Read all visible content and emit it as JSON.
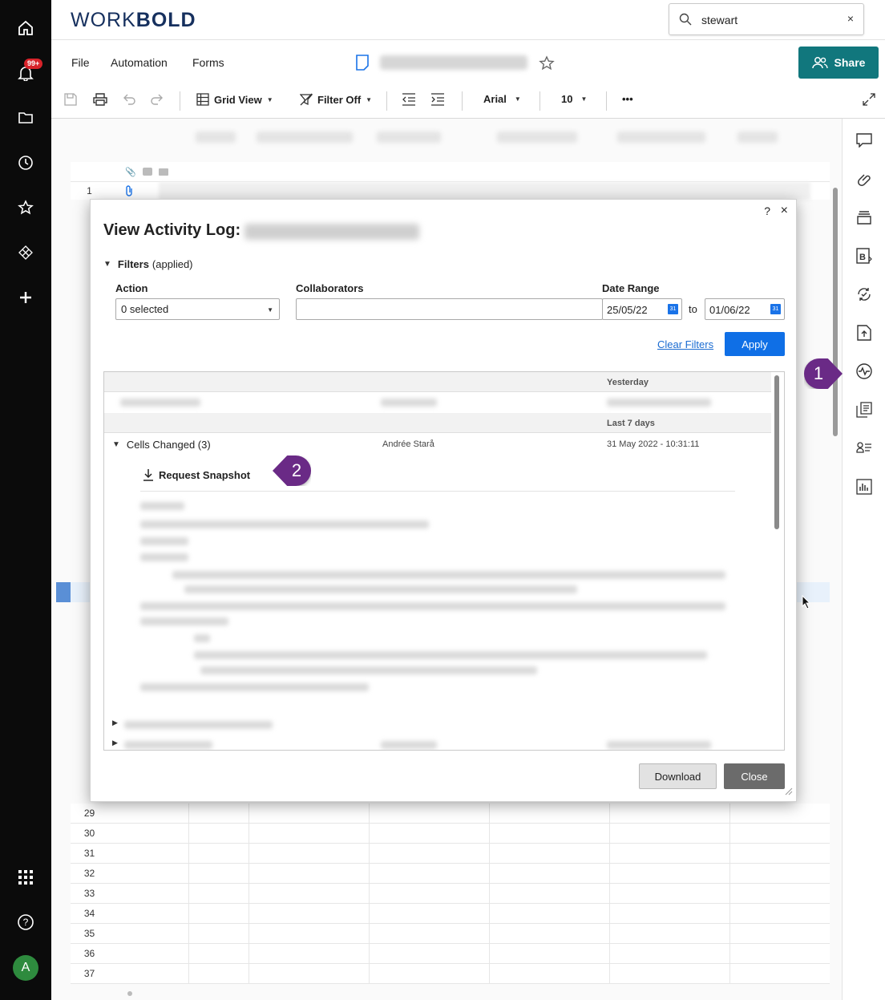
{
  "app": {
    "logo_light": "WORK",
    "logo_bold": "BOLD"
  },
  "leftnav": {
    "notification_badge": "99+",
    "avatar_initial": "A"
  },
  "search": {
    "value": "stewart",
    "clear": "×"
  },
  "menu": {
    "file": "File",
    "automation": "Automation",
    "forms": "Forms",
    "share": "Share"
  },
  "toolbar": {
    "grid_view": "Grid View",
    "filter": "Filter Off",
    "font": "Arial",
    "font_size": "10",
    "more": "•••"
  },
  "sheet": {
    "first_row": "1",
    "row_numbers": [
      "29",
      "30",
      "31",
      "32",
      "33",
      "34",
      "35",
      "36",
      "37"
    ]
  },
  "dialog": {
    "help": "?",
    "close": "×",
    "title": "View Activity Log:",
    "filters_label": "Filters",
    "filters_state": "(applied)",
    "action_label": "Action",
    "action_value": "0 selected",
    "collaborators_label": "Collaborators",
    "collaborators_value": "",
    "date_range_label": "Date Range",
    "date_from": "25/05/22",
    "date_to": "01/06/22",
    "to_label": "to",
    "clear_filters": "Clear Filters",
    "apply": "Apply",
    "group_yesterday": "Yesterday",
    "group_last7": "Last 7 days",
    "entry_title": "Cells Changed (3)",
    "entry_user": "Andrée Starå",
    "entry_time": "31 May 2022 - 10:31:11",
    "request_snapshot": "Request Snapshot",
    "download": "Download",
    "close_button": "Close"
  },
  "callouts": {
    "one": "1",
    "two": "2"
  },
  "colors": {
    "brand_navy": "#16305e",
    "share_teal": "#11777d",
    "apply_blue": "#0f6fe6",
    "callout_purple": "#6a2a86",
    "badge_red": "#d8232a"
  }
}
